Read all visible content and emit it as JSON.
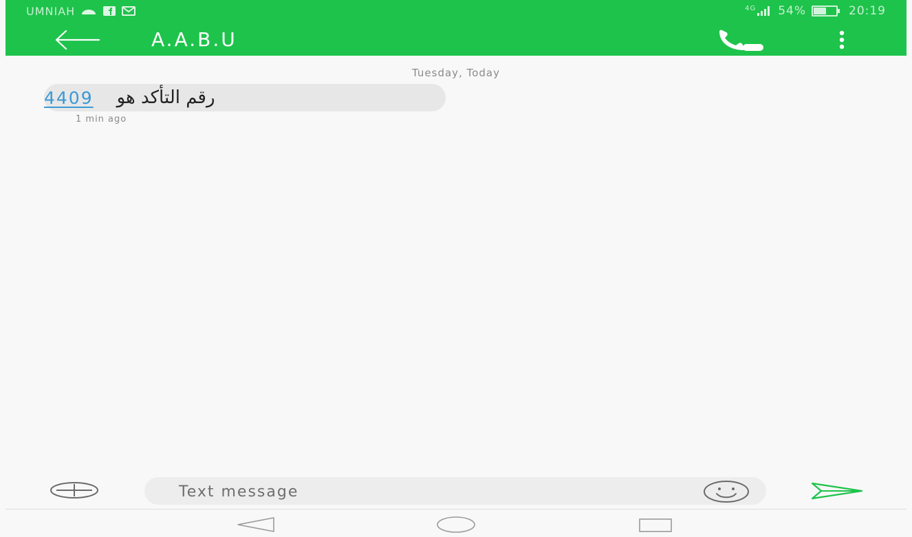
{
  "status_bar": {
    "carrier": "UMNIAH",
    "network": "4G",
    "battery": "54%",
    "battery_level": 0.54,
    "time": "20:19",
    "notification_icons": [
      "cloud-icon",
      "facebook-icon",
      "mail-icon"
    ]
  },
  "header": {
    "contact_name": "A.A.B.U",
    "accent_color": "#1ec34b"
  },
  "conversation": {
    "date_separator": "Tuesday, Today",
    "messages": [
      {
        "text": "رقم التأكد هو",
        "code": "4409",
        "time": "1 min ago"
      }
    ]
  },
  "composer": {
    "placeholder": "Text message",
    "value": ""
  },
  "colors": {
    "link": "#3a99d6",
    "send": "#1ec34b"
  }
}
